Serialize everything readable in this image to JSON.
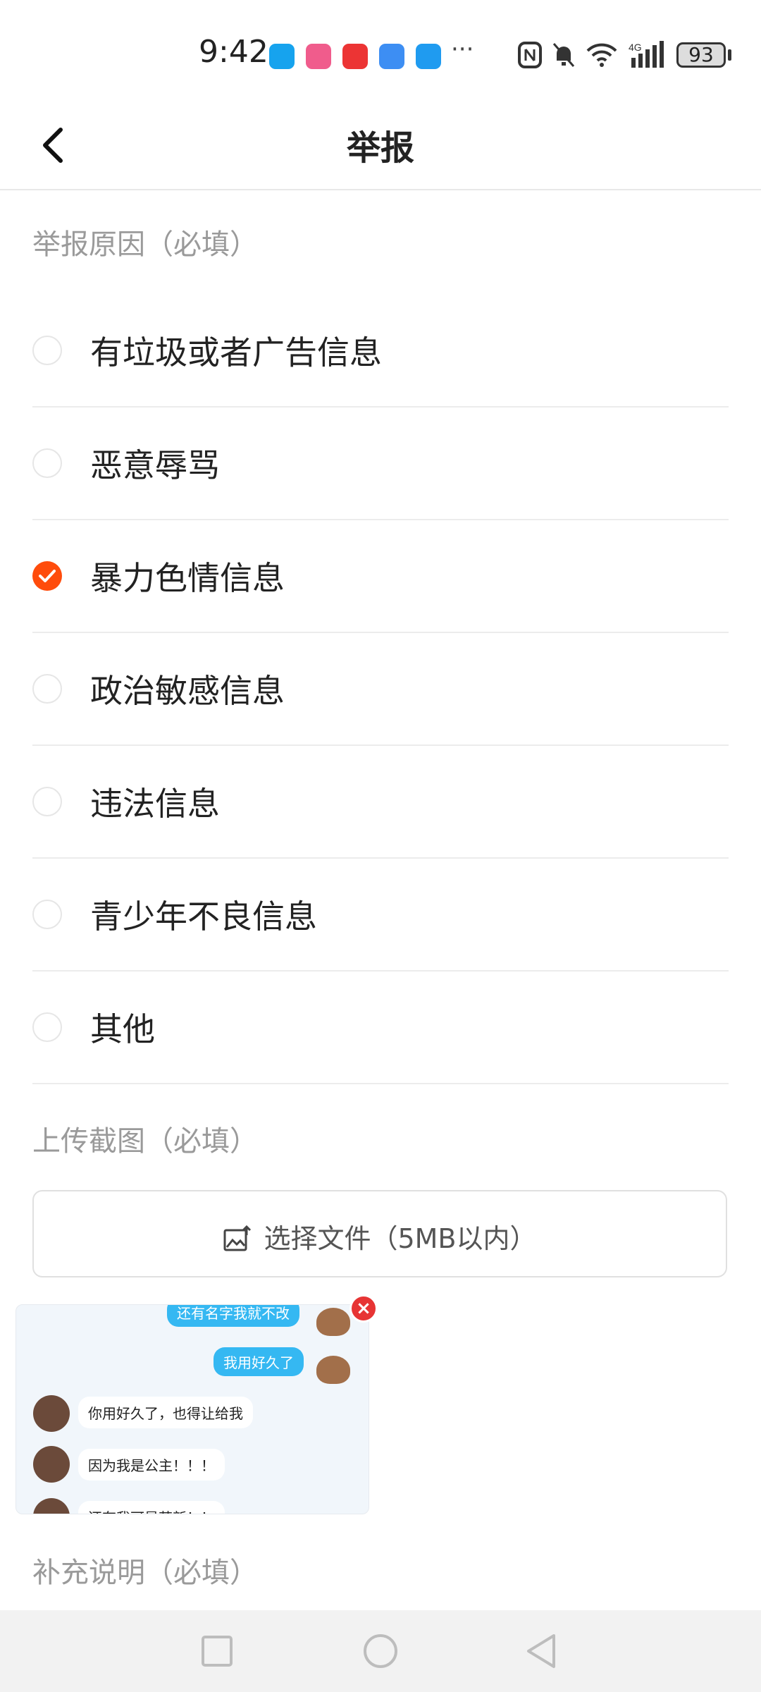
{
  "status_bar": {
    "time": "9:42",
    "battery": "93",
    "network": "4G",
    "more": "···",
    "icons": [
      "message-app-icon",
      "bilibili-app-icon",
      "red-app-icon",
      "cloud-app-icon",
      "weather-app-icon",
      "nfc-icon",
      "bell-muted-icon",
      "wifi-icon",
      "signal-icon",
      "battery-icon"
    ]
  },
  "header": {
    "title": "举报",
    "back_icon": "back-arrow-icon"
  },
  "reason": {
    "label": "举报原因（必填）",
    "options": [
      {
        "label": "有垃圾或者广告信息",
        "checked": false
      },
      {
        "label": "恶意辱骂",
        "checked": false
      },
      {
        "label": "暴力色情信息",
        "checked": true
      },
      {
        "label": "政治敏感信息",
        "checked": false
      },
      {
        "label": "违法信息",
        "checked": false
      },
      {
        "label": "青少年不良信息",
        "checked": false
      },
      {
        "label": "其他",
        "checked": false
      }
    ]
  },
  "upload": {
    "label": "上传截图（必填）",
    "button_label": "选择文件（5MB以内）",
    "icon": "image-upload-icon"
  },
  "screenshot_preview": {
    "messages": [
      {
        "side": "right",
        "text": "还有名字我就不改"
      },
      {
        "side": "right",
        "text": "我用好久了"
      },
      {
        "side": "left",
        "text": "你用好久了，也得让给我"
      },
      {
        "side": "left",
        "text": "因为我是公主！！！"
      },
      {
        "side": "left",
        "text": "还有我可是萌新！！"
      }
    ],
    "delete_icon": "close-icon"
  },
  "note": {
    "label": "补充说明（必填）"
  },
  "nav": {
    "icons": [
      "recent-apps-icon",
      "home-icon",
      "back-icon"
    ]
  },
  "colors": {
    "accent": "#ff4c0c",
    "bubble": "#35b8f2",
    "delete": "#e73434"
  }
}
